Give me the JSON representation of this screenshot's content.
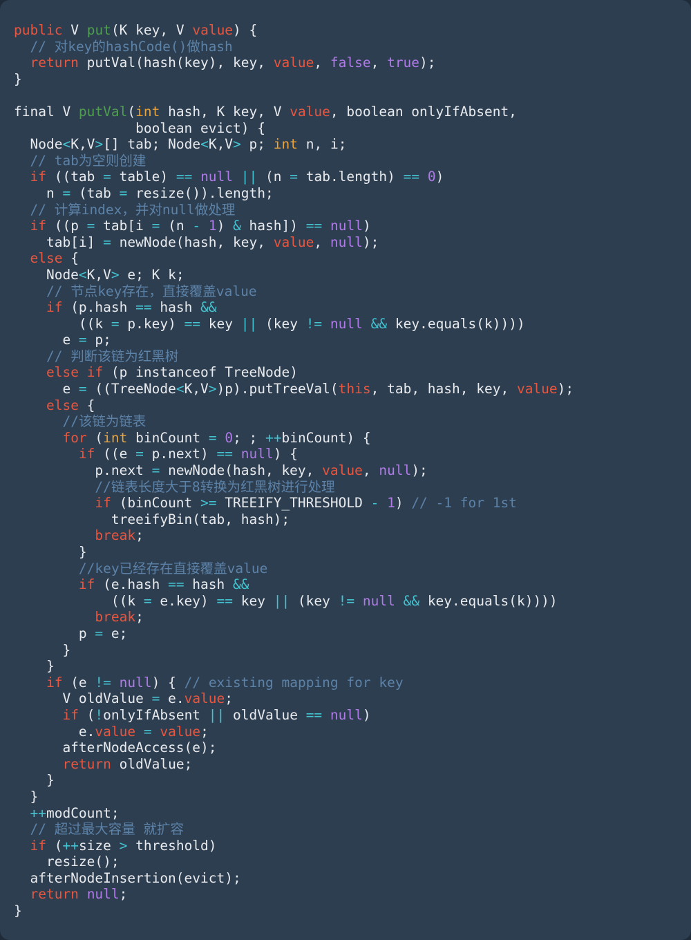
{
  "editor": {
    "background": "#2d3e50",
    "page_background": "#1f2b38",
    "language": "java",
    "colors": {
      "keyword": "#e8563f",
      "method": "#4f9d4f",
      "type": "#e8a33d",
      "operator": "#44c3d0",
      "literal": "#b07ae8",
      "comment": "#5c82a8",
      "plain": "#e8eaed"
    }
  },
  "code": {
    "title": "HashMap put / putVal source",
    "lines": [
      "public V put(K key, V value) {",
      "  // 对key的hashCode()做hash",
      "  return putVal(hash(key), key, value, false, true);",
      "}",
      "",
      "final V putVal(int hash, K key, V value, boolean onlyIfAbsent,",
      "               boolean evict) {",
      "  Node<K,V>[] tab; Node<K,V> p; int n, i;",
      "  // tab为空则创建",
      "  if ((tab = table) == null || (n = tab.length) == 0)",
      "    n = (tab = resize()).length;",
      "  // 计算index，并对null做处理",
      "  if ((p = tab[i = (n - 1) & hash]) == null)",
      "    tab[i] = newNode(hash, key, value, null);",
      "  else {",
      "    Node<K,V> e; K k;",
      "    // 节点key存在，直接覆盖value",
      "    if (p.hash == hash &&",
      "        ((k = p.key) == key || (key != null && key.equals(k))))",
      "      e = p;",
      "    // 判断该链为红黑树",
      "    else if (p instanceof TreeNode)",
      "      e = ((TreeNode<K,V>)p).putTreeVal(this, tab, hash, key, value);",
      "    else {",
      "      //该链为链表",
      "      for (int binCount = 0; ; ++binCount) {",
      "        if ((e = p.next) == null) {",
      "          p.next = newNode(hash, key, value, null);",
      "          //链表长度大于8转换为红黑树进行处理",
      "          if (binCount >= TREEIFY_THRESHOLD - 1) // -1 for 1st",
      "            treeifyBin(tab, hash);",
      "          break;",
      "        }",
      "        //key已经存在直接覆盖value",
      "        if (e.hash == hash &&",
      "            ((k = e.key) == key || (key != null && key.equals(k))))",
      "          break;",
      "        p = e;",
      "      }",
      "    }",
      "    if (e != null) { // existing mapping for key",
      "      V oldValue = e.value;",
      "      if (!onlyIfAbsent || oldValue == null)",
      "        e.value = value;",
      "      afterNodeAccess(e);",
      "      return oldValue;",
      "    }",
      "  }",
      "  ++modCount;",
      "  // 超过最大容量 就扩容",
      "  if (++size > threshold)",
      "    resize();",
      "  afterNodeInsertion(evict);",
      "  return null;",
      "}"
    ],
    "tokens": {
      "keywords": [
        "public",
        "return",
        "final",
        "if",
        "else",
        "for",
        "break",
        "boolean"
      ],
      "types": [
        "int"
      ],
      "literals": [
        "null",
        "true",
        "false",
        "0",
        "1",
        "8"
      ],
      "methods": [
        "put",
        "putVal"
      ],
      "operators": [
        "=",
        "==",
        "!=",
        "||",
        "&&",
        "&",
        "-",
        "++",
        ">=",
        ">",
        "!"
      ],
      "identifiers_highlighted": [
        "value",
        "this"
      ]
    },
    "comments": [
      "// 对key的hashCode()做hash",
      "// tab为空则创建",
      "// 计算index，并对null做处理",
      "// 节点key存在，直接覆盖value",
      "// 判断该链为红黑树",
      "//该链为链表",
      "//链表长度大于8转换为红黑树进行处理",
      "// -1 for 1st",
      "//key已经存在直接覆盖value",
      "// existing mapping for key",
      "// 超过最大容量 就扩容"
    ]
  }
}
